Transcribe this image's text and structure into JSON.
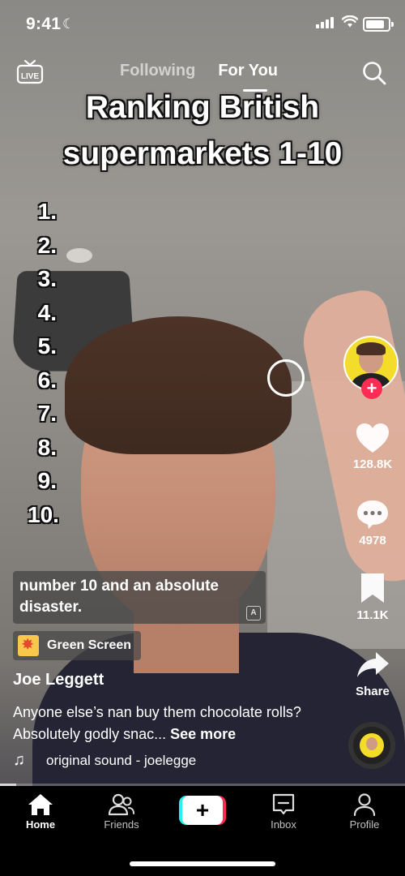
{
  "status_bar": {
    "time": "9:41"
  },
  "top_nav": {
    "live_label": "LIVE",
    "tab_following": "Following",
    "tab_for_you": "For You"
  },
  "video": {
    "title_line1": "Ranking British",
    "title_line2": "supermarkets 1-10",
    "ranks": [
      "1.",
      "2.",
      "3.",
      "4.",
      "5.",
      "6.",
      "7.",
      "8.",
      "9.",
      "10."
    ],
    "caption": "number 10 and an absolute disaster."
  },
  "actions": {
    "likes": "128.8K",
    "comments": "4978",
    "saves": "11.1K",
    "share_label": "Share"
  },
  "post": {
    "effect": "Green Screen",
    "author": "Joe Leggett",
    "description": "Anyone else’s nan buy them chocolate rolls? Absolutely godly snac...",
    "see_more": "See more",
    "sound": "original sound - joelegge",
    "progress": 0.04
  },
  "bottom_nav": {
    "home": "Home",
    "friends": "Friends",
    "inbox": "Inbox",
    "profile": "Profile"
  },
  "colors": {
    "accent_pink": "#fe2c55",
    "accent_cyan": "#25f4ee",
    "avatar_yellow": "#f3dc2a"
  },
  "icons": [
    "live-icon",
    "search-icon",
    "heart-icon",
    "comment-icon",
    "bookmark-icon",
    "share-icon",
    "music-note-icon",
    "home-icon",
    "friends-icon",
    "plus-icon",
    "inbox-icon",
    "profile-icon"
  ]
}
